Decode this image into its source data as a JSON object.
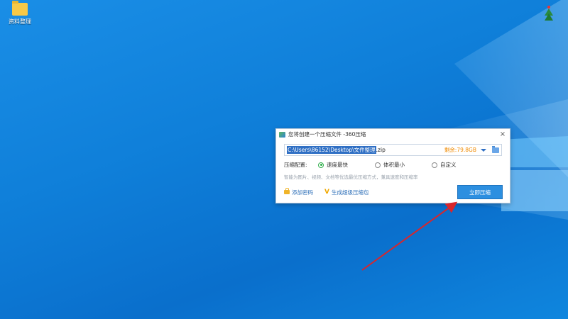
{
  "desktop": {
    "icons": [
      {
        "label": "资料整理",
        "icon": "folder-icon"
      }
    ]
  },
  "dialog": {
    "title": "您将创建一个压缩文件 -360压缩",
    "path": {
      "selected": "C:\\Users\\86152\\Desktop\\文件整理",
      "extension": ".zip",
      "free_space": "剩余:79.8GB"
    },
    "config": {
      "label": "压缩配置:",
      "options": [
        {
          "label": "速度最快",
          "selected": true
        },
        {
          "label": "体积最小",
          "selected": false
        },
        {
          "label": "自定义",
          "selected": false
        }
      ]
    },
    "hint": "智能为图片、视频、文档等优选最优压缩方式，兼具速度和压缩率",
    "add_password": "添加密码",
    "self_extract": "生成超级压缩包",
    "compress_button": "立即压缩"
  },
  "colors": {
    "accent": "#2c8fe0",
    "selected_radio": "#2fae4a",
    "free_space": "#f08a00",
    "annotation_arrow": "#d9262b"
  }
}
